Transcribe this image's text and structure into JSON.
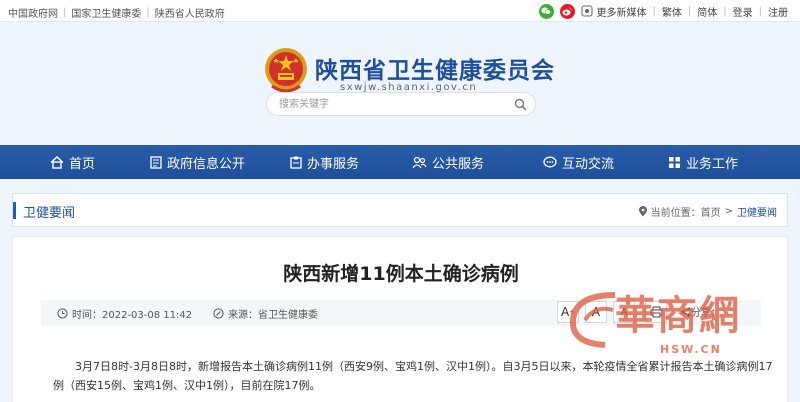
{
  "topbar": {
    "links": [
      "中国政府网",
      "国家卫生健康委",
      "陕西省人民政府"
    ],
    "more_media": "更多新媒体",
    "traditional": "繁体",
    "simplified": "简体",
    "login": "登录",
    "register": "注册"
  },
  "header": {
    "title": "陕西省卫生健康委员会",
    "domain": "sxwjw.shaanxi.gov.cn",
    "search_placeholder": "搜索关键字"
  },
  "nav": [
    "首页",
    "政府信息公开",
    "办事服务",
    "公共服务",
    "互动交流",
    "业务工作"
  ],
  "section": {
    "title": "卫健要闻",
    "breadcrumb_label": "当前位置：",
    "breadcrumb_home": "首页",
    "breadcrumb_sep": ">",
    "breadcrumb_current": "卫健要闻"
  },
  "article": {
    "title": "陕西新增11例本土确诊病例",
    "time": "时间：2022-03-08 11:42",
    "source": "来源：省卫生健康委",
    "font_large": "A",
    "font_large_sup": "+",
    "font_medium": "A",
    "font_small": "A",
    "share": "分享：",
    "body": "3月7日8时-3月8日8时，新增报告本土确诊病例11例（西安9例、宝鸡1例、汉中1例）。自3月5日以来，本轮疫情全省累计报告本土确诊病例17例（西安15例、宝鸡1例、汉中1例），目前在院17例。"
  },
  "watermark": {
    "text": "華商網",
    "url": "HSW.CN"
  },
  "colors": {
    "brand_blue": "#1e4f9c",
    "nav_blue": "#2a5ca9",
    "wechat_green": "#3cb035",
    "weibo_red": "#e6162d"
  }
}
